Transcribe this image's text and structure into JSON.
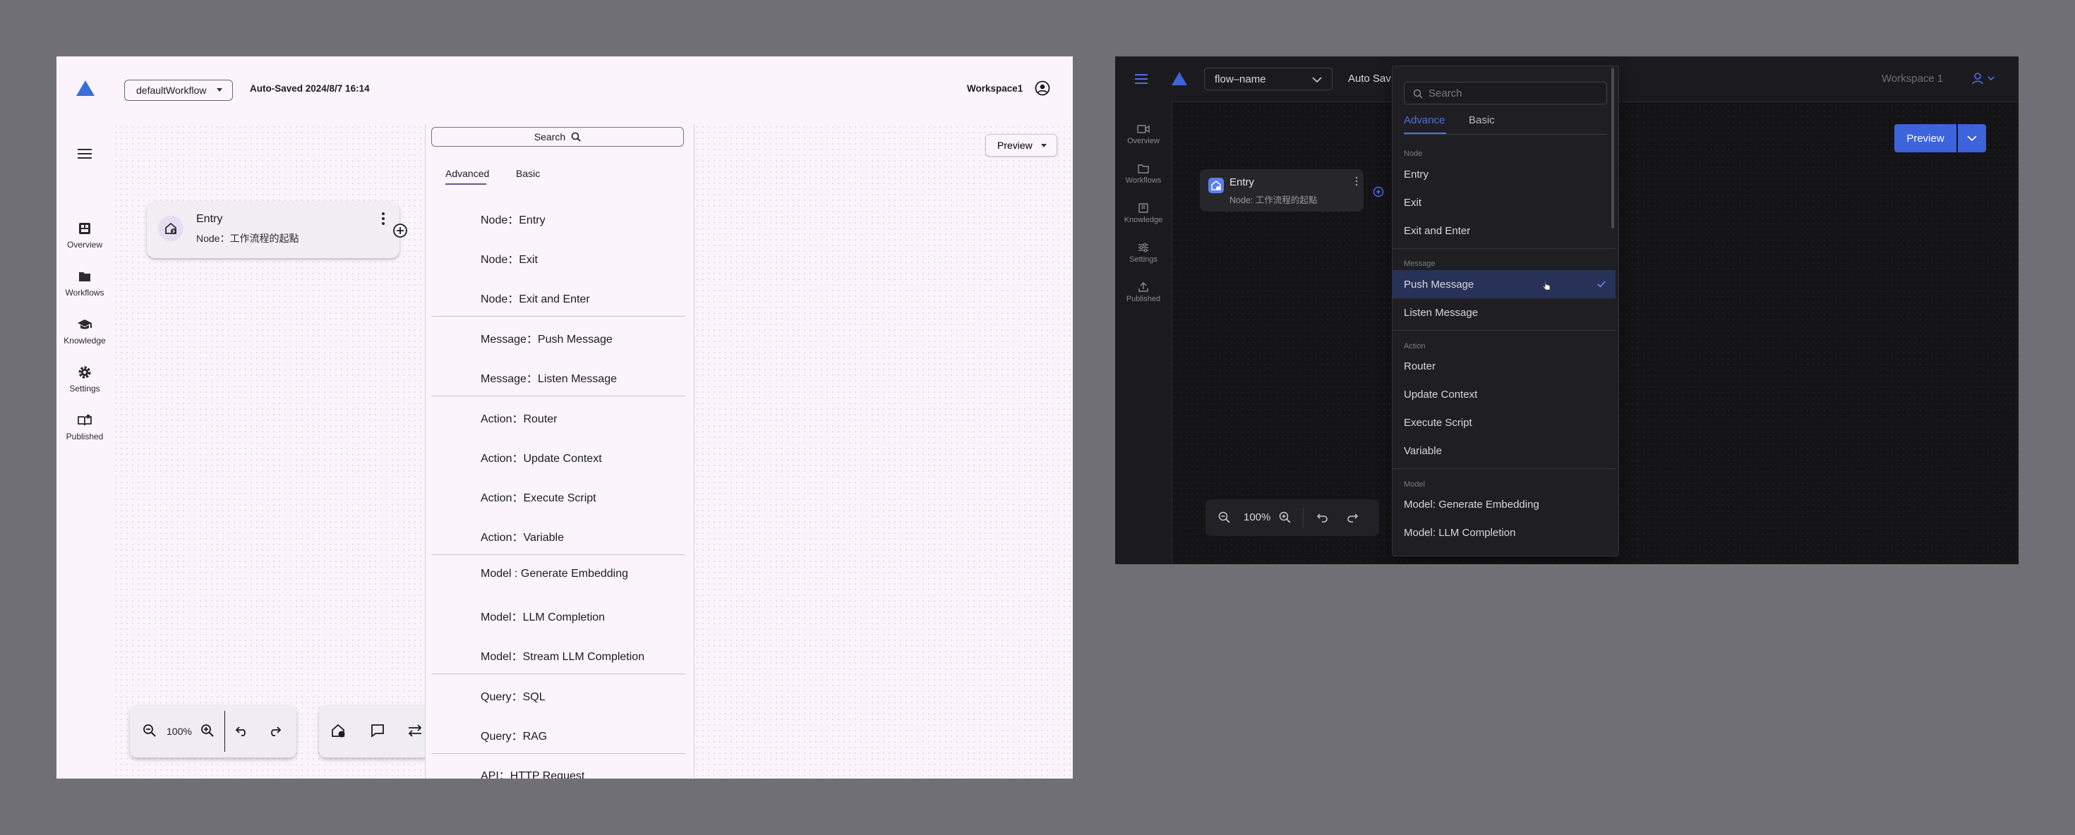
{
  "light": {
    "workflow_select": "defaultWorkflow",
    "autosave": "Auto-Saved 2024/8/7 16:14",
    "workspace": "Workspace1",
    "nav": [
      {
        "label": "Overview"
      },
      {
        "label": "Workflows"
      },
      {
        "label": "Knowledge"
      },
      {
        "label": "Settings"
      },
      {
        "label": "Published"
      }
    ],
    "node": {
      "title": "Entry",
      "subtitle": "Node：工作流程的起點"
    },
    "panel": {
      "search_label": "Search",
      "tabs": [
        "Advanced",
        "Basic"
      ],
      "items": [
        "Node：Entry",
        "Node：Exit",
        "Node：Exit and Enter",
        "Message：Push Message",
        "Message：Listen Message",
        "Action：Router",
        "Action：Update Context",
        "Action：Execute Script",
        "Action：Variable",
        "Model : Generate Embedding",
        "Model：LLM Completion",
        "Model：Stream LLM Completion",
        "Query：SQL",
        "Query：RAG",
        "API：HTTP Request"
      ]
    },
    "preview": "Preview",
    "zoom": "100%"
  },
  "dark": {
    "workflow_select": "flow–name",
    "autosave_partial": "Auto Sav",
    "workspace": "Workspace 1",
    "nav": [
      {
        "label": "Overview"
      },
      {
        "label": "Workflows"
      },
      {
        "label": "Knowledge"
      },
      {
        "label": "Settings"
      },
      {
        "label": "Published"
      }
    ],
    "node": {
      "title": "Entry",
      "subtitle": "Node: 工作流程的起點"
    },
    "preview": "Preview",
    "zoom": "100%",
    "menu": {
      "search_placeholder": "Search",
      "tabs": [
        "Advance",
        "Basic"
      ],
      "groups": [
        {
          "title": "Node",
          "items": [
            "Entry",
            "Exit",
            "Exit and Enter"
          ]
        },
        {
          "title": "Message",
          "items": [
            "Push Message",
            "Listen Message"
          ]
        },
        {
          "title": "Action",
          "items": [
            "Router",
            "Update Context",
            "Execute Script",
            "Variable"
          ]
        },
        {
          "title": "Model",
          "items": [
            "Model: Generate Embedding",
            "Model: LLM Completion"
          ]
        }
      ],
      "selected": "Push Message"
    },
    "colors": {
      "accent": "#3d63dd",
      "selected_bg": "#283258"
    }
  }
}
